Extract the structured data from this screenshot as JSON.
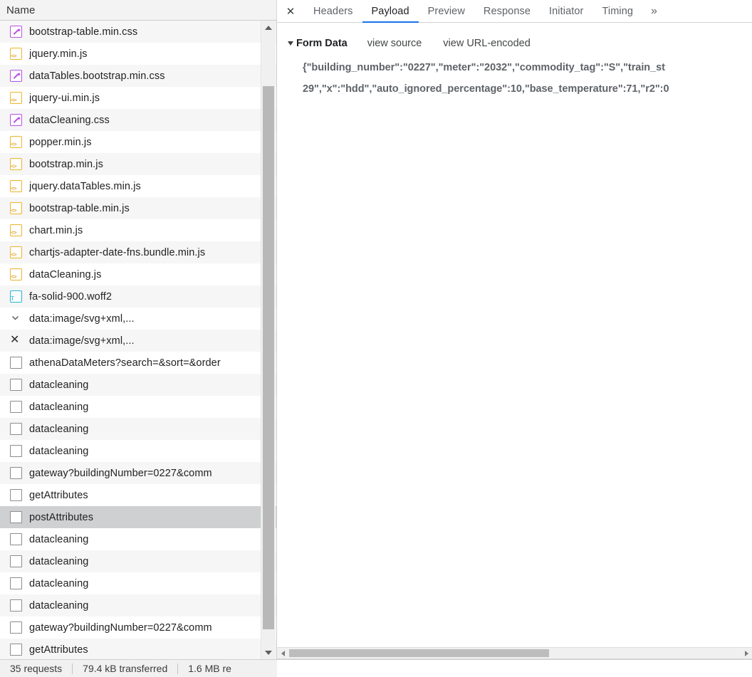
{
  "panel_left": {
    "header": {
      "column_name": "Name"
    },
    "rows": [
      {
        "icon": "stylesheet-icon",
        "label": "bootstrap-table.min.css",
        "selected": false
      },
      {
        "icon": "script-icon",
        "label": "jquery.min.js",
        "selected": false
      },
      {
        "icon": "stylesheet-icon",
        "label": "dataTables.bootstrap.min.css",
        "selected": false
      },
      {
        "icon": "script-icon",
        "label": "jquery-ui.min.js",
        "selected": false
      },
      {
        "icon": "stylesheet-icon",
        "label": "dataCleaning.css",
        "selected": false
      },
      {
        "icon": "script-icon",
        "label": "popper.min.js",
        "selected": false
      },
      {
        "icon": "script-icon",
        "label": "bootstrap.min.js",
        "selected": false
      },
      {
        "icon": "script-icon",
        "label": "jquery.dataTables.min.js",
        "selected": false
      },
      {
        "icon": "script-icon",
        "label": "bootstrap-table.min.js",
        "selected": false
      },
      {
        "icon": "script-icon",
        "label": "chart.min.js",
        "selected": false
      },
      {
        "icon": "script-icon",
        "label": "chartjs-adapter-date-fns.bundle.min.js",
        "selected": false
      },
      {
        "icon": "script-icon",
        "label": "dataCleaning.js",
        "selected": false
      },
      {
        "icon": "font-icon",
        "label": "fa-solid-900.woff2",
        "selected": false
      },
      {
        "icon": "chevron-down-icon",
        "label": "data:image/svg+xml,...",
        "selected": false
      },
      {
        "icon": "close-x-icon",
        "label": "data:image/svg+xml,...",
        "selected": false
      },
      {
        "icon": "document-icon",
        "label": "athenaDataMeters?search=&sort=&order",
        "selected": false
      },
      {
        "icon": "document-icon",
        "label": "datacleaning",
        "selected": false
      },
      {
        "icon": "document-icon",
        "label": "datacleaning",
        "selected": false
      },
      {
        "icon": "document-icon",
        "label": "datacleaning",
        "selected": false
      },
      {
        "icon": "document-icon",
        "label": "datacleaning",
        "selected": false
      },
      {
        "icon": "document-icon",
        "label": "gateway?buildingNumber=0227&comm",
        "selected": false
      },
      {
        "icon": "document-icon",
        "label": "getAttributes",
        "selected": false
      },
      {
        "icon": "document-icon",
        "label": "postAttributes",
        "selected": true
      },
      {
        "icon": "document-icon",
        "label": "datacleaning",
        "selected": false
      },
      {
        "icon": "document-icon",
        "label": "datacleaning",
        "selected": false
      },
      {
        "icon": "document-icon",
        "label": "datacleaning",
        "selected": false
      },
      {
        "icon": "document-icon",
        "label": "datacleaning",
        "selected": false
      },
      {
        "icon": "document-icon",
        "label": "gateway?buildingNumber=0227&comm",
        "selected": false
      },
      {
        "icon": "document-icon",
        "label": "getAttributes",
        "selected": false
      }
    ]
  },
  "panel_right": {
    "close_label": "✕",
    "tabs": [
      {
        "label": "Headers",
        "active": false
      },
      {
        "label": "Payload",
        "active": true
      },
      {
        "label": "Preview",
        "active": false
      },
      {
        "label": "Response",
        "active": false
      },
      {
        "label": "Initiator",
        "active": false
      },
      {
        "label": "Timing",
        "active": false
      }
    ],
    "more_tabs_label": "»",
    "form_data": {
      "section_title": "Form Data",
      "view_source_label": "view source",
      "view_url_encoded_label": "view URL-encoded",
      "json_line_1": "{\"building_number\":\"0227\",\"meter\":\"2032\",\"commodity_tag\":\"S\",\"train_st",
      "json_line_2": "29\",\"x\":\"hdd\",\"auto_ignored_percentage\":10,\"base_temperature\":71,\"r2\":0"
    }
  },
  "statusbar": {
    "requests": "35 requests",
    "transferred": "79.4 kB transferred",
    "resources": "1.6 MB re"
  },
  "colors": {
    "accent_tab": "#1a73e8",
    "stylesheet_icon": "#b750e8",
    "script_icon": "#f0b429",
    "font_icon": "#1fb6d8",
    "selected_row": "#cfd0d2"
  }
}
